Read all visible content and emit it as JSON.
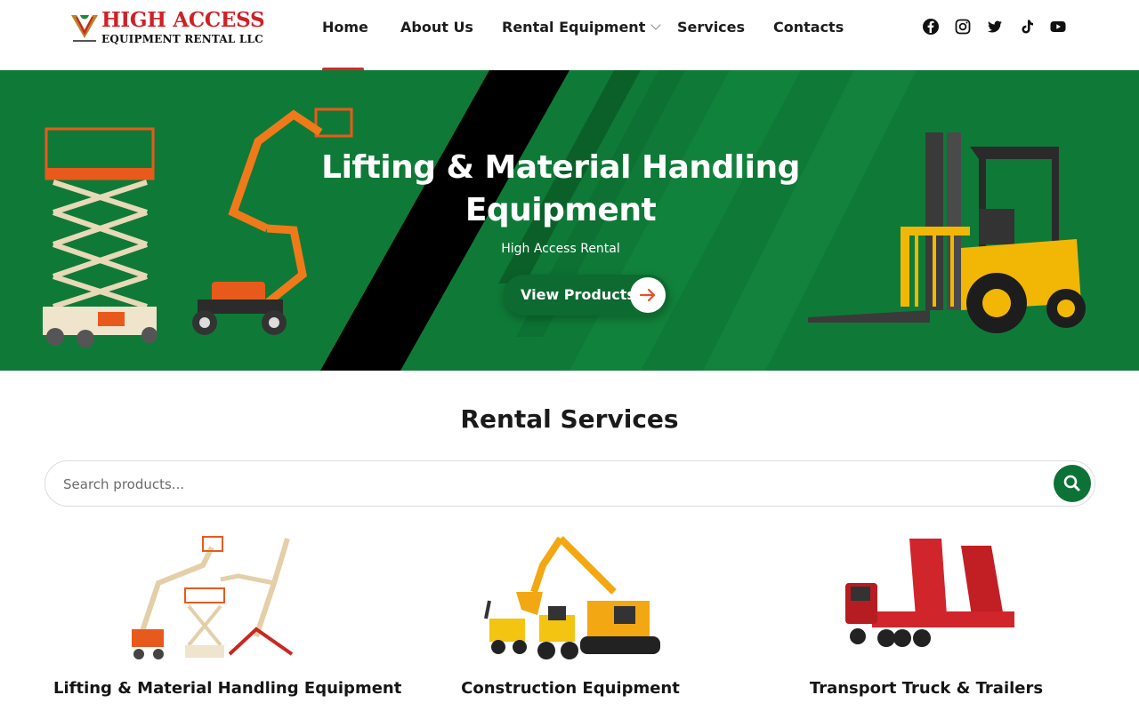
{
  "brand": {
    "name_line1": "HIGH ACCESS",
    "name_line2": "EQUIPMENT RENTAL  LLC",
    "colors": {
      "red": "#cf2027",
      "green": "#0f7a37"
    }
  },
  "nav": {
    "items": [
      {
        "label": "Home",
        "active": true
      },
      {
        "label": "About Us"
      },
      {
        "label": "Rental Equipment",
        "has_dropdown": true
      },
      {
        "label": "Services"
      },
      {
        "label": "Contacts"
      }
    ]
  },
  "social": [
    "facebook-icon",
    "instagram-icon",
    "twitter-icon",
    "tiktok-icon",
    "youtube-icon"
  ],
  "hero": {
    "title": "Lifting & Material Handling Equipment",
    "subtitle": "High Access Rental",
    "button_label": "View Products"
  },
  "section": {
    "title": "Rental Services"
  },
  "search": {
    "placeholder": "Search products..."
  },
  "cards": [
    {
      "title": "Lifting & Material Handling Equipment"
    },
    {
      "title": "Construction Equipment"
    },
    {
      "title": "Transport Truck & Trailers"
    }
  ]
}
